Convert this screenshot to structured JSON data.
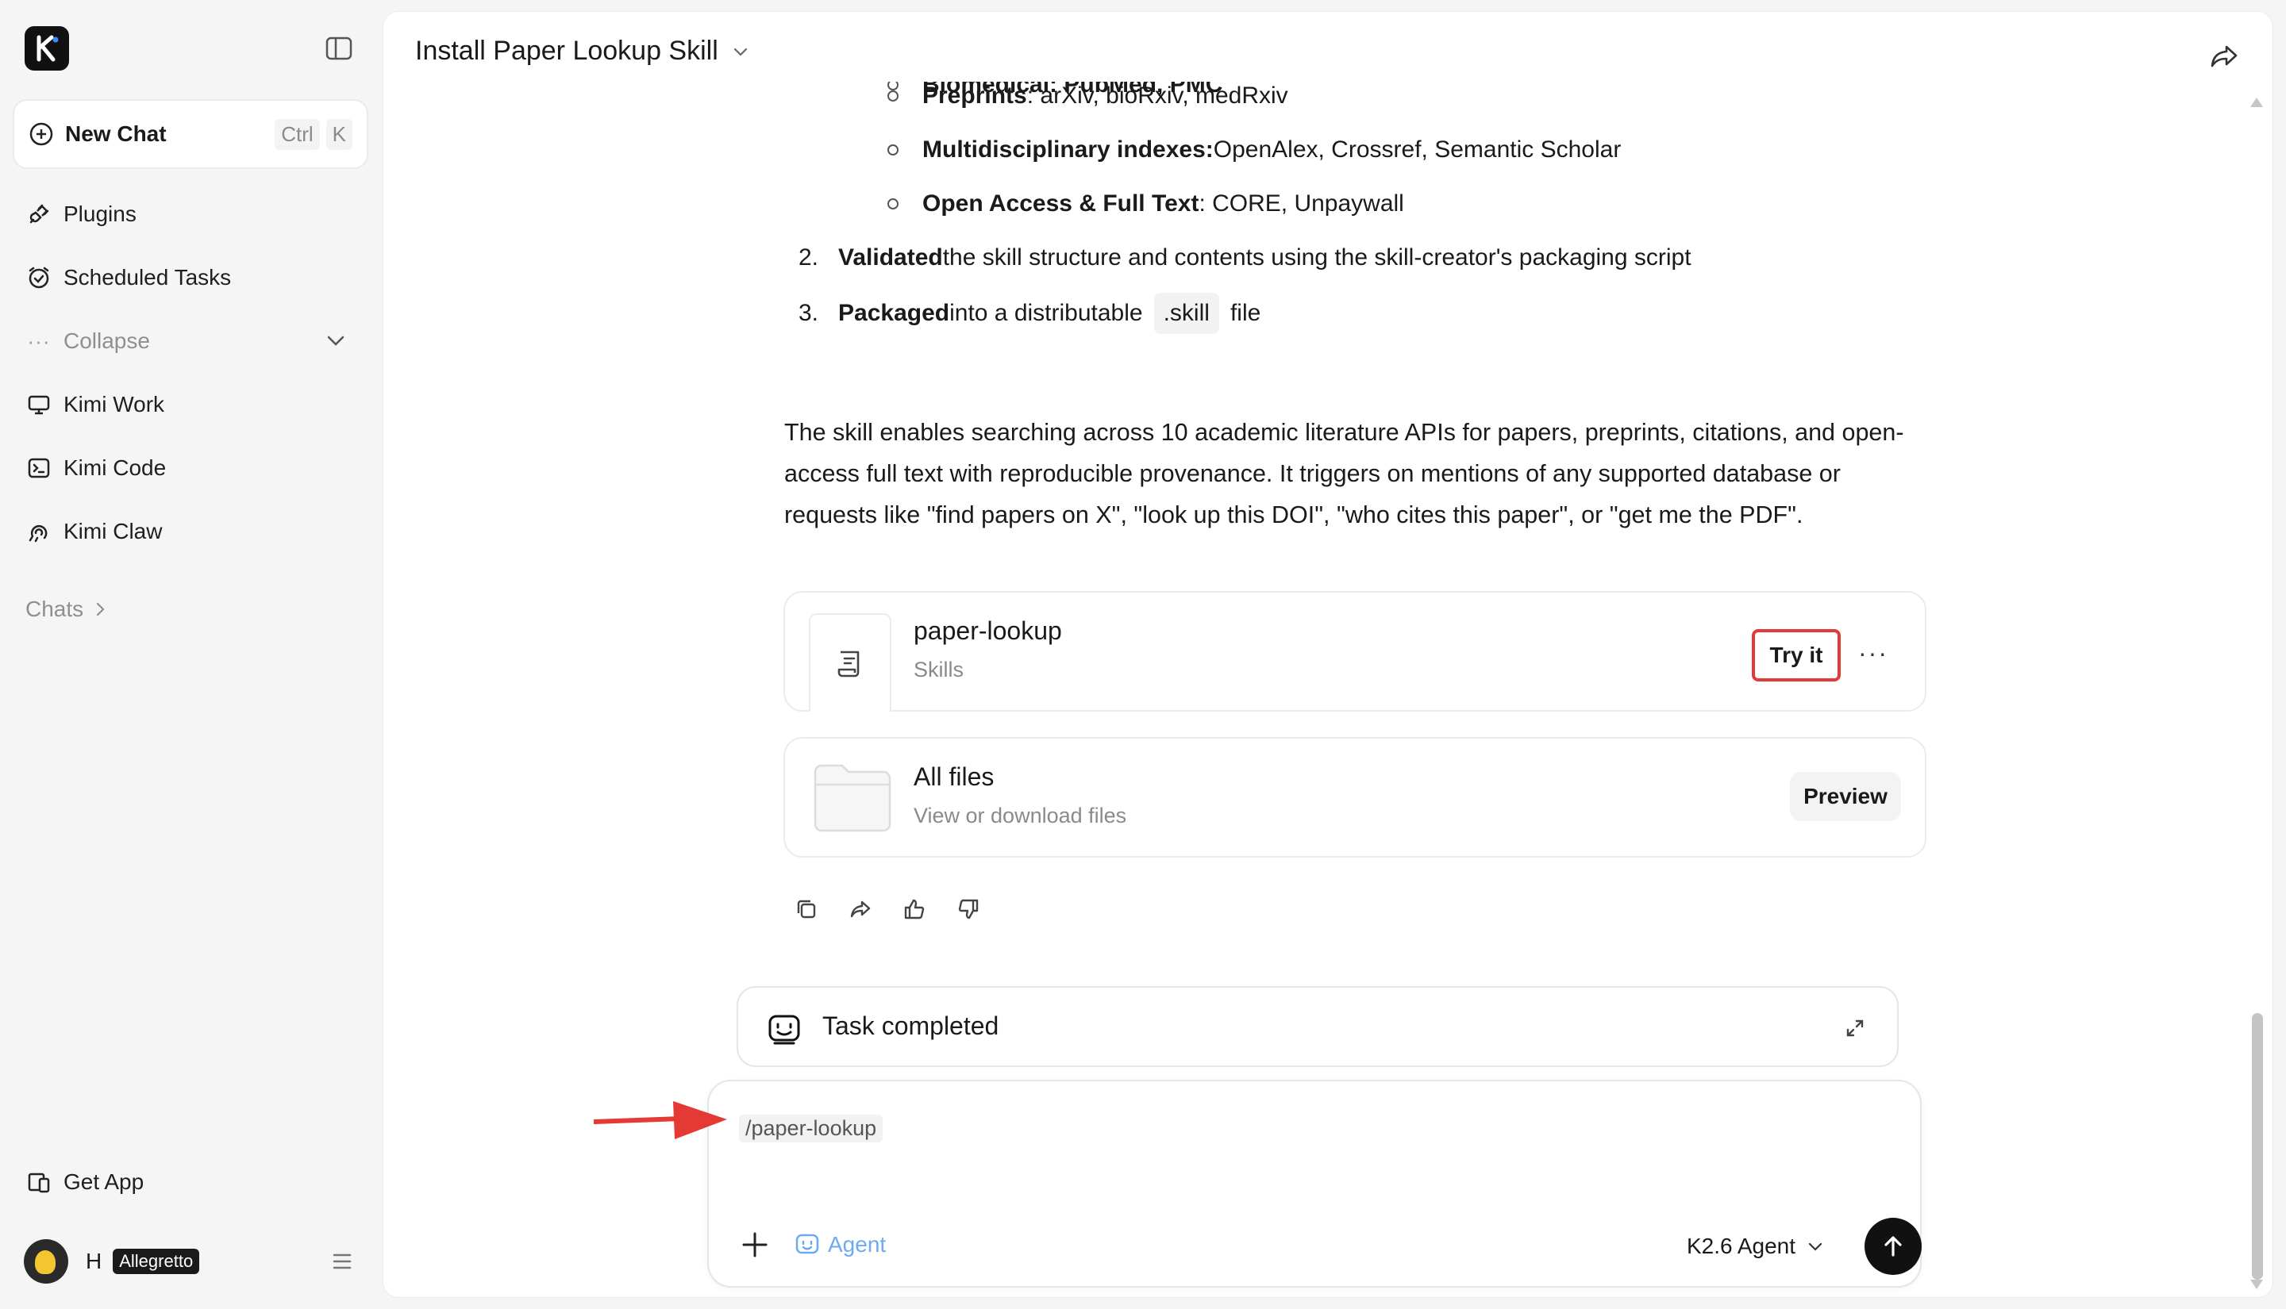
{
  "sidebar": {
    "new_chat": {
      "label": "New Chat",
      "kbd1": "Ctrl",
      "kbd2": "K"
    },
    "items": [
      {
        "label": "Plugins"
      },
      {
        "label": "Scheduled Tasks"
      },
      {
        "label": "Collapse"
      },
      {
        "label": "Kimi Work"
      },
      {
        "label": "Kimi Code"
      },
      {
        "label": "Kimi Claw"
      }
    ],
    "chats_label": "Chats",
    "get_app": "Get App",
    "user": {
      "initial": "H",
      "badge": "Allegretto"
    }
  },
  "header": {
    "title": "Install Paper Lookup Skill"
  },
  "message": {
    "cut_line": "Biomedical: PubMed, PMC",
    "bullets": [
      {
        "bold": "Preprints",
        "text": ": arXiv, bioRxiv, medRxiv"
      },
      {
        "bold": "Multidisciplinary indexes:",
        "text": " OpenAlex, Crossref, Semantic Scholar"
      },
      {
        "bold": "Open Access & Full Text",
        "text": ": CORE, Unpaywall"
      }
    ],
    "steps": [
      {
        "num": "2.",
        "bold": "Validated",
        "text": " the skill structure and contents using the skill-creator's packaging script"
      },
      {
        "num": "3.",
        "bold": "Packaged",
        "text": " into a distributable",
        "code": ".skill",
        "tail": "file"
      }
    ],
    "paragraph": "The skill enables searching across 10 academic literature APIs for papers, preprints, citations, and open-access full text with reproducible provenance. It triggers on mentions of any supported database or requests like \"find papers on X\", \"look up this DOI\", \"who cites this paper\", or \"get me the PDF\".",
    "skill_card": {
      "title": "paper-lookup",
      "subtitle": "Skills",
      "try_label": "Try it",
      "more": "···"
    },
    "files_card": {
      "title": "All files",
      "subtitle": "View or download files",
      "preview_label": "Preview"
    }
  },
  "task_bar": {
    "label": "Task completed"
  },
  "composer": {
    "slash_command": "/paper-lookup",
    "agent_label": "Agent",
    "model_label": "K2.6 Agent"
  },
  "colors": {
    "accent_red": "#e53935",
    "agent_blue": "#6ea9f5"
  }
}
